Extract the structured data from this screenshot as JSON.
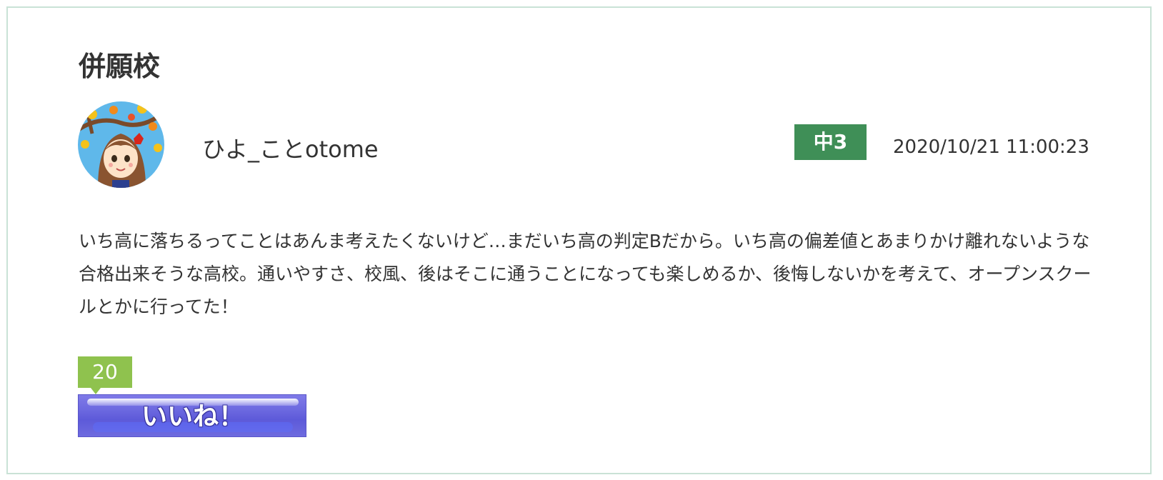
{
  "post": {
    "section_title": "併願校",
    "author": {
      "username": "ひよ_ことotome",
      "avatar_icon": "avatar-girl-autumn-leaves-icon"
    },
    "grade_badge": "中3",
    "timestamp": "2020/10/21 11:00:23",
    "body": "いち高に落ちるってことはあんま考えたくないけど…まだいち高の判定Bだから。いち高の偏差値とあまりかけ離れないような合格出来そうな高校。通いやすさ、校風、後はそこに通うことになっても楽しめるか、後悔しないかを考えて、オープンスクールとかに行ってた！",
    "like_count": "20",
    "like_label": "いいね！"
  },
  "colors": {
    "card_border": "#c9e2d6",
    "grade_badge_bg": "#3f8f57",
    "like_count_bg": "#8fc24e",
    "like_button_bg": "#6d69e0"
  }
}
